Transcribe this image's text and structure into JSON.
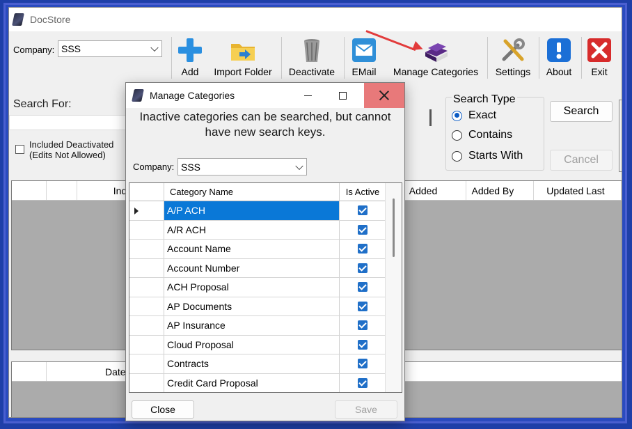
{
  "window": {
    "title": "DocStore"
  },
  "toolbar": {
    "company_label": "Company:",
    "company_value": "SSS",
    "buttons": [
      {
        "label": "Add",
        "icon": "add-icon"
      },
      {
        "label": "Import Folder",
        "icon": "folder-icon"
      },
      {
        "label": "Deactivate",
        "icon": "trash-icon"
      },
      {
        "label": "EMail",
        "icon": "email-icon"
      },
      {
        "label": "Manage Categories",
        "icon": "categories-icon"
      },
      {
        "label": "Settings",
        "icon": "settings-icon"
      },
      {
        "label": "About",
        "icon": "info-icon"
      },
      {
        "label": "Exit",
        "icon": "exit-icon"
      }
    ]
  },
  "search": {
    "label": "Search For:",
    "value": "",
    "include_deactivated_line1": "Included Deactivated",
    "include_deactivated_line2": "(Edits Not Allowed)",
    "search_type": {
      "legend": "Search Type",
      "options": [
        "Exact",
        "Contains",
        "Starts With"
      ],
      "selected": "Exact"
    },
    "search_button": "Search",
    "cancel_button": "Cancel"
  },
  "results_grid": {
    "headers": [
      "Ind",
      "Added",
      "Added By",
      "Updated Last"
    ]
  },
  "lower_grid": {
    "headers": [
      "Date"
    ]
  },
  "dialog": {
    "title": "Manage Categories",
    "message": "Inactive categories can be searched, but cannot have new search keys.",
    "company_label": "Company:",
    "company_value": "SSS",
    "columns": [
      "Category Name",
      "Is Active"
    ],
    "rows": [
      {
        "name": "A/P ACH",
        "active": true
      },
      {
        "name": "A/R ACH",
        "active": true
      },
      {
        "name": "Account Name",
        "active": true
      },
      {
        "name": "Account Number",
        "active": true
      },
      {
        "name": "ACH Proposal",
        "active": true
      },
      {
        "name": "AP Documents",
        "active": true
      },
      {
        "name": "AP Insurance",
        "active": true
      },
      {
        "name": "Cloud Proposal",
        "active": true
      },
      {
        "name": "Contracts",
        "active": true
      },
      {
        "name": "Credit Card Proposal",
        "active": true
      }
    ],
    "close_button": "Close",
    "save_button": "Save"
  },
  "colors": {
    "selection": "#0a78d7",
    "checkbox": "#1f6fc8",
    "close_hover": "#e8797a",
    "annotation_arrow": "#e23b3b",
    "outer_frame": "#1e3fa8"
  }
}
